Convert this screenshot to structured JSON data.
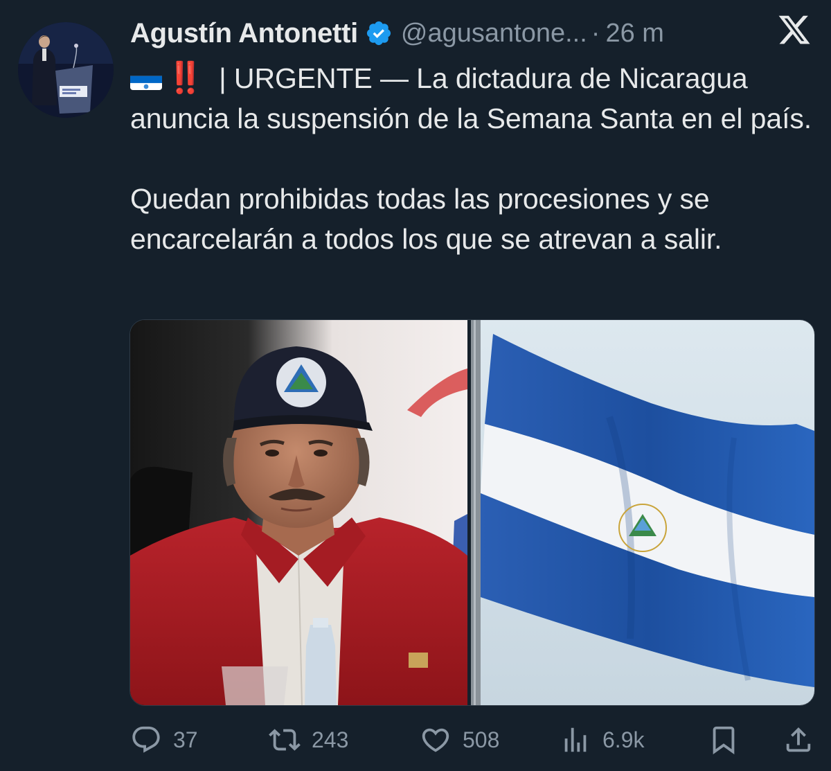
{
  "author": {
    "name": "Agustín Antonetti",
    "handle": "@agusantone...",
    "separator": "·",
    "time": "26 m",
    "verified": true
  },
  "post": {
    "flag_emoji": "nicaragua-flag-icon",
    "exclamation": "‼️",
    "line1": " | URGENTE — La dictadura de Nicaragua anuncia la suspensión de la Semana Santa en el país.",
    "paragraph2": "Quedan prohibidas todas las procesiones y se encarcelarán a todos los que se atrevan a salir."
  },
  "media": {
    "images": [
      "photo-man-red-jacket-cap",
      "photo-nicaragua-flag"
    ]
  },
  "actions": {
    "replies": "37",
    "reposts": "243",
    "likes": "508",
    "views": "6.9k"
  },
  "colors": {
    "background": "#15202b",
    "text": "#e7e9ea",
    "muted": "#8b98a5",
    "verified": "#1d9bf0",
    "urgent": "#e0242e"
  },
  "icons": [
    "x-logo-icon",
    "verified-badge-icon",
    "reply-icon",
    "repost-icon",
    "like-icon",
    "views-icon",
    "bookmark-icon",
    "share-icon"
  ]
}
